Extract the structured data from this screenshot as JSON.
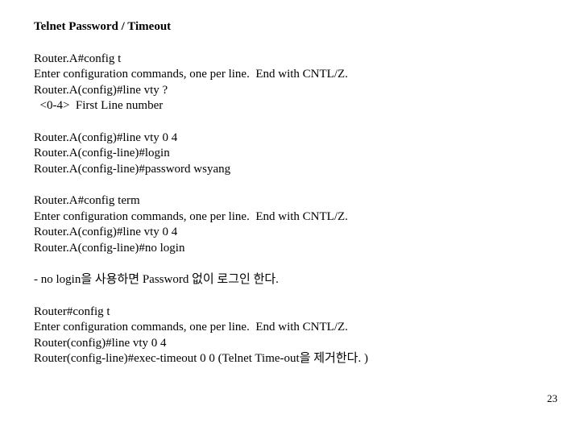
{
  "title": "Telnet Password / Timeout",
  "block1": {
    "l1": "Router.A#config t",
    "l2": "Enter configuration commands, one per line.  End with CNTL/Z.",
    "l3": "Router.A(config)#line vty ?",
    "l4": "  <0-4>  First Line number"
  },
  "block2": {
    "l1": "Router.A(config)#line vty 0 4",
    "l2": "Router.A(config-line)#login",
    "l3": "Router.A(config-line)#password wsyang"
  },
  "block3": {
    "l1": "Router.A#config term",
    "l2": "Enter configuration commands, one per line.  End with CNTL/Z.",
    "l3": "Router.A(config)#line vty 0 4",
    "l4": "Router.A(config-line)#no login"
  },
  "note1": "- no login을 사용하면 Password 없이 로그인 한다.",
  "block4": {
    "l1": "Router#config t",
    "l2": "Enter configuration commands, one per line.  End with CNTL/Z.",
    "l3": "Router(config)#line vty 0 4",
    "l4": "Router(config-line)#exec-timeout 0 0 (Telnet Time-out을 제거한다. )"
  },
  "pageNumber": "23"
}
